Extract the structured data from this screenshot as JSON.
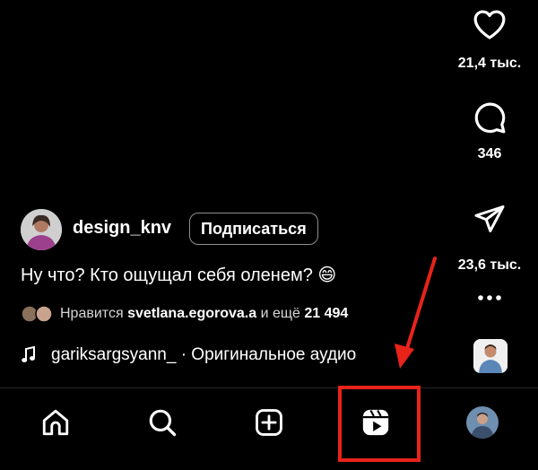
{
  "colors": {
    "background": "#000000",
    "text": "#ffffff",
    "annotation": "#e8231a",
    "muted": "#d6d6d6"
  },
  "rail": {
    "like_count": "21,4 тыс.",
    "comment_count": "346",
    "share_count": "23,6 тыс.",
    "more_icon": "more-horizontal-icon"
  },
  "post": {
    "username": "design_knv",
    "follow_label": "Подписаться",
    "caption": "Ну что? Кто ощущал себя оленем?",
    "caption_emoji": "😄",
    "likes_prefix": "Нравится",
    "likes_user": "svetlana.egorova.a",
    "likes_middle": "и ещё",
    "likes_count": "21 494",
    "audio_text": "gariksargsyann_ · Оригинальное аудио"
  },
  "nav": {
    "items": [
      "home-icon",
      "search-icon",
      "create-icon",
      "reels-icon",
      "profile-avatar"
    ],
    "highlighted": "reels-icon"
  }
}
